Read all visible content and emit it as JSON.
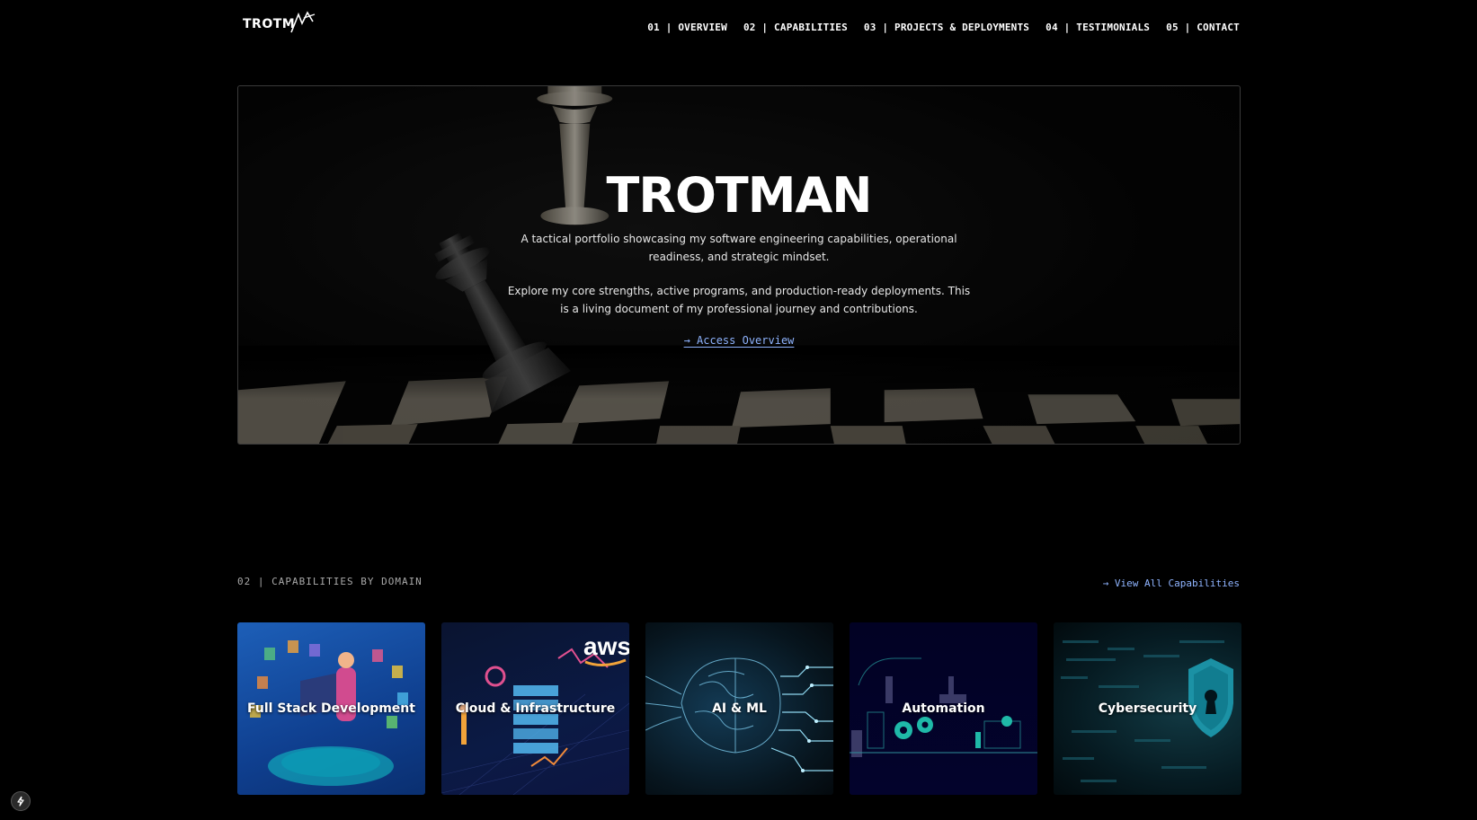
{
  "header": {
    "logo_text": "TROTM",
    "nav": [
      "01 | OVERVIEW",
      "02 | CAPABILITIES",
      "03 | PROJECTS & DEPLOYMENTS",
      "04 | TESTIMONIALS",
      "05 | CONTACT"
    ]
  },
  "hero": {
    "title": "TROTMAN",
    "paragraph_1": "A tactical portfolio showcasing my software engineering capabilities, operational readiness, and strategic mindset.",
    "paragraph_2": "Explore my core strengths, active programs, and production-ready deployments. This is a living document of my professional journey and contributions.",
    "cta": "→ Access Overview"
  },
  "capabilities": {
    "section_label": "02 | CAPABILITIES BY DOMAIN",
    "view_all": "→ View All Capabilities",
    "cards": [
      "Full Stack Development",
      "Cloud & Infrastructure",
      "AI & ML",
      "Automation",
      "Cybersecurity"
    ],
    "aws_logo_text": "aws"
  },
  "colors": {
    "background": "#000000",
    "accent_link": "#8fb4ff",
    "muted_text": "#a9a9a9"
  },
  "icons": [
    "logo-mark-icon",
    "lightning-icon"
  ]
}
